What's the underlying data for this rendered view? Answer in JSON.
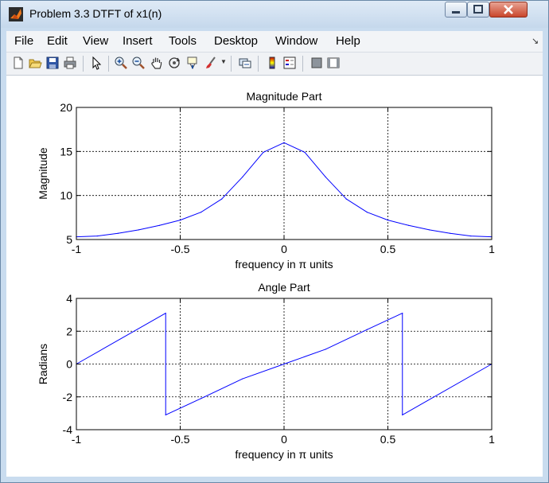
{
  "window": {
    "title": "Problem 3.3 DTFT of x1(n)"
  },
  "menu": [
    "File",
    "Edit",
    "View",
    "Insert",
    "Tools",
    "Desktop",
    "Window",
    "Help"
  ],
  "toolbar_icons": [
    "new-file-icon",
    "open-folder-icon",
    "save-icon",
    "print-icon",
    "pointer-arrow-icon",
    "zoom-in-icon",
    "zoom-out-icon",
    "pan-hand-icon",
    "rotate-3d-icon",
    "data-cursor-icon",
    "brush-icon",
    "link-icon",
    "colorbar-icon",
    "legend-icon",
    "hide-plot-tools-icon",
    "show-plot-tools-icon"
  ],
  "colors": {
    "line": "#0000ff",
    "axes": "#000000",
    "grid": "#000000",
    "background": "#ffffff",
    "window_chrome": "#c9dcef"
  },
  "chart_data": [
    {
      "type": "line",
      "title": "Magnitude Part",
      "xlabel": "frequency in π units",
      "ylabel": "Magnitude",
      "xlim": [
        -1,
        1
      ],
      "ylim": [
        5,
        20
      ],
      "xticks": [
        "-1",
        "-0.5",
        "0",
        "0.5",
        "1"
      ],
      "yticks": [
        "5",
        "10",
        "15",
        "20"
      ],
      "grid": true,
      "x": [
        -1.0,
        -0.9,
        -0.8,
        -0.7,
        -0.6,
        -0.5,
        -0.4,
        -0.3,
        -0.2,
        -0.1,
        0.0,
        0.1,
        0.2,
        0.3,
        0.4,
        0.5,
        0.6,
        0.7,
        0.8,
        0.9,
        1.0
      ],
      "y": [
        5.3,
        5.4,
        5.7,
        6.1,
        6.6,
        7.2,
        8.1,
        9.6,
        12.1,
        14.9,
        16.0,
        14.9,
        12.1,
        9.6,
        8.1,
        7.2,
        6.6,
        6.1,
        5.7,
        5.4,
        5.3
      ]
    },
    {
      "type": "line",
      "title": "Angle Part",
      "xlabel": "frequency in π units",
      "ylabel": "Radians",
      "xlim": [
        -1,
        1
      ],
      "ylim": [
        -4,
        4
      ],
      "xticks": [
        "-1",
        "-0.5",
        "0",
        "0.5",
        "1"
      ],
      "yticks": [
        "-4",
        "-2",
        "0",
        "2",
        "4"
      ],
      "grid": true,
      "x": [
        -1.0,
        -0.57,
        -0.57,
        -0.4,
        -0.2,
        0.0,
        0.2,
        0.4,
        0.57,
        0.57,
        1.0
      ],
      "y": [
        0.0,
        3.1,
        -3.1,
        -2.1,
        -0.9,
        0.0,
        0.9,
        2.1,
        3.1,
        -3.1,
        0.0
      ]
    }
  ]
}
